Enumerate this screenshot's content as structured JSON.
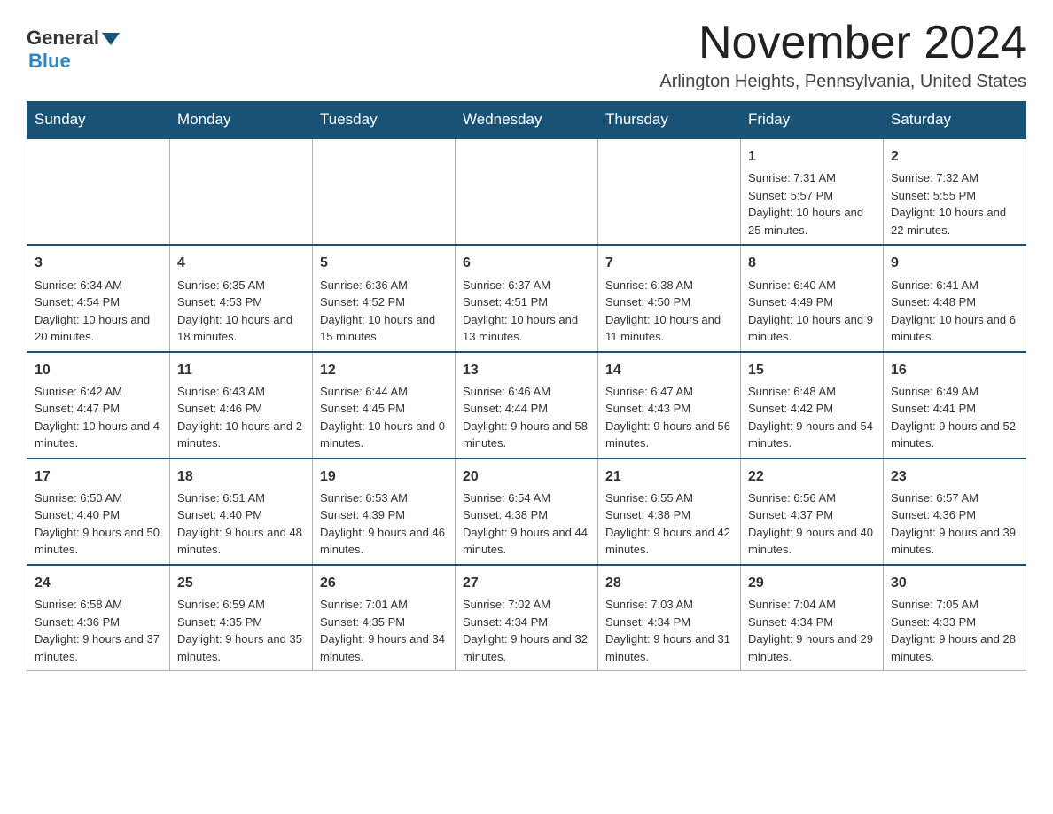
{
  "logo": {
    "general": "General",
    "blue": "Blue"
  },
  "title": "November 2024",
  "subtitle": "Arlington Heights, Pennsylvania, United States",
  "days_of_week": [
    "Sunday",
    "Monday",
    "Tuesday",
    "Wednesday",
    "Thursday",
    "Friday",
    "Saturday"
  ],
  "weeks": [
    [
      {
        "day": "",
        "info": ""
      },
      {
        "day": "",
        "info": ""
      },
      {
        "day": "",
        "info": ""
      },
      {
        "day": "",
        "info": ""
      },
      {
        "day": "",
        "info": ""
      },
      {
        "day": "1",
        "info": "Sunrise: 7:31 AM\nSunset: 5:57 PM\nDaylight: 10 hours and 25 minutes."
      },
      {
        "day": "2",
        "info": "Sunrise: 7:32 AM\nSunset: 5:55 PM\nDaylight: 10 hours and 22 minutes."
      }
    ],
    [
      {
        "day": "3",
        "info": "Sunrise: 6:34 AM\nSunset: 4:54 PM\nDaylight: 10 hours and 20 minutes."
      },
      {
        "day": "4",
        "info": "Sunrise: 6:35 AM\nSunset: 4:53 PM\nDaylight: 10 hours and 18 minutes."
      },
      {
        "day": "5",
        "info": "Sunrise: 6:36 AM\nSunset: 4:52 PM\nDaylight: 10 hours and 15 minutes."
      },
      {
        "day": "6",
        "info": "Sunrise: 6:37 AM\nSunset: 4:51 PM\nDaylight: 10 hours and 13 minutes."
      },
      {
        "day": "7",
        "info": "Sunrise: 6:38 AM\nSunset: 4:50 PM\nDaylight: 10 hours and 11 minutes."
      },
      {
        "day": "8",
        "info": "Sunrise: 6:40 AM\nSunset: 4:49 PM\nDaylight: 10 hours and 9 minutes."
      },
      {
        "day": "9",
        "info": "Sunrise: 6:41 AM\nSunset: 4:48 PM\nDaylight: 10 hours and 6 minutes."
      }
    ],
    [
      {
        "day": "10",
        "info": "Sunrise: 6:42 AM\nSunset: 4:47 PM\nDaylight: 10 hours and 4 minutes."
      },
      {
        "day": "11",
        "info": "Sunrise: 6:43 AM\nSunset: 4:46 PM\nDaylight: 10 hours and 2 minutes."
      },
      {
        "day": "12",
        "info": "Sunrise: 6:44 AM\nSunset: 4:45 PM\nDaylight: 10 hours and 0 minutes."
      },
      {
        "day": "13",
        "info": "Sunrise: 6:46 AM\nSunset: 4:44 PM\nDaylight: 9 hours and 58 minutes."
      },
      {
        "day": "14",
        "info": "Sunrise: 6:47 AM\nSunset: 4:43 PM\nDaylight: 9 hours and 56 minutes."
      },
      {
        "day": "15",
        "info": "Sunrise: 6:48 AM\nSunset: 4:42 PM\nDaylight: 9 hours and 54 minutes."
      },
      {
        "day": "16",
        "info": "Sunrise: 6:49 AM\nSunset: 4:41 PM\nDaylight: 9 hours and 52 minutes."
      }
    ],
    [
      {
        "day": "17",
        "info": "Sunrise: 6:50 AM\nSunset: 4:40 PM\nDaylight: 9 hours and 50 minutes."
      },
      {
        "day": "18",
        "info": "Sunrise: 6:51 AM\nSunset: 4:40 PM\nDaylight: 9 hours and 48 minutes."
      },
      {
        "day": "19",
        "info": "Sunrise: 6:53 AM\nSunset: 4:39 PM\nDaylight: 9 hours and 46 minutes."
      },
      {
        "day": "20",
        "info": "Sunrise: 6:54 AM\nSunset: 4:38 PM\nDaylight: 9 hours and 44 minutes."
      },
      {
        "day": "21",
        "info": "Sunrise: 6:55 AM\nSunset: 4:38 PM\nDaylight: 9 hours and 42 minutes."
      },
      {
        "day": "22",
        "info": "Sunrise: 6:56 AM\nSunset: 4:37 PM\nDaylight: 9 hours and 40 minutes."
      },
      {
        "day": "23",
        "info": "Sunrise: 6:57 AM\nSunset: 4:36 PM\nDaylight: 9 hours and 39 minutes."
      }
    ],
    [
      {
        "day": "24",
        "info": "Sunrise: 6:58 AM\nSunset: 4:36 PM\nDaylight: 9 hours and 37 minutes."
      },
      {
        "day": "25",
        "info": "Sunrise: 6:59 AM\nSunset: 4:35 PM\nDaylight: 9 hours and 35 minutes."
      },
      {
        "day": "26",
        "info": "Sunrise: 7:01 AM\nSunset: 4:35 PM\nDaylight: 9 hours and 34 minutes."
      },
      {
        "day": "27",
        "info": "Sunrise: 7:02 AM\nSunset: 4:34 PM\nDaylight: 9 hours and 32 minutes."
      },
      {
        "day": "28",
        "info": "Sunrise: 7:03 AM\nSunset: 4:34 PM\nDaylight: 9 hours and 31 minutes."
      },
      {
        "day": "29",
        "info": "Sunrise: 7:04 AM\nSunset: 4:34 PM\nDaylight: 9 hours and 29 minutes."
      },
      {
        "day": "30",
        "info": "Sunrise: 7:05 AM\nSunset: 4:33 PM\nDaylight: 9 hours and 28 minutes."
      }
    ]
  ]
}
